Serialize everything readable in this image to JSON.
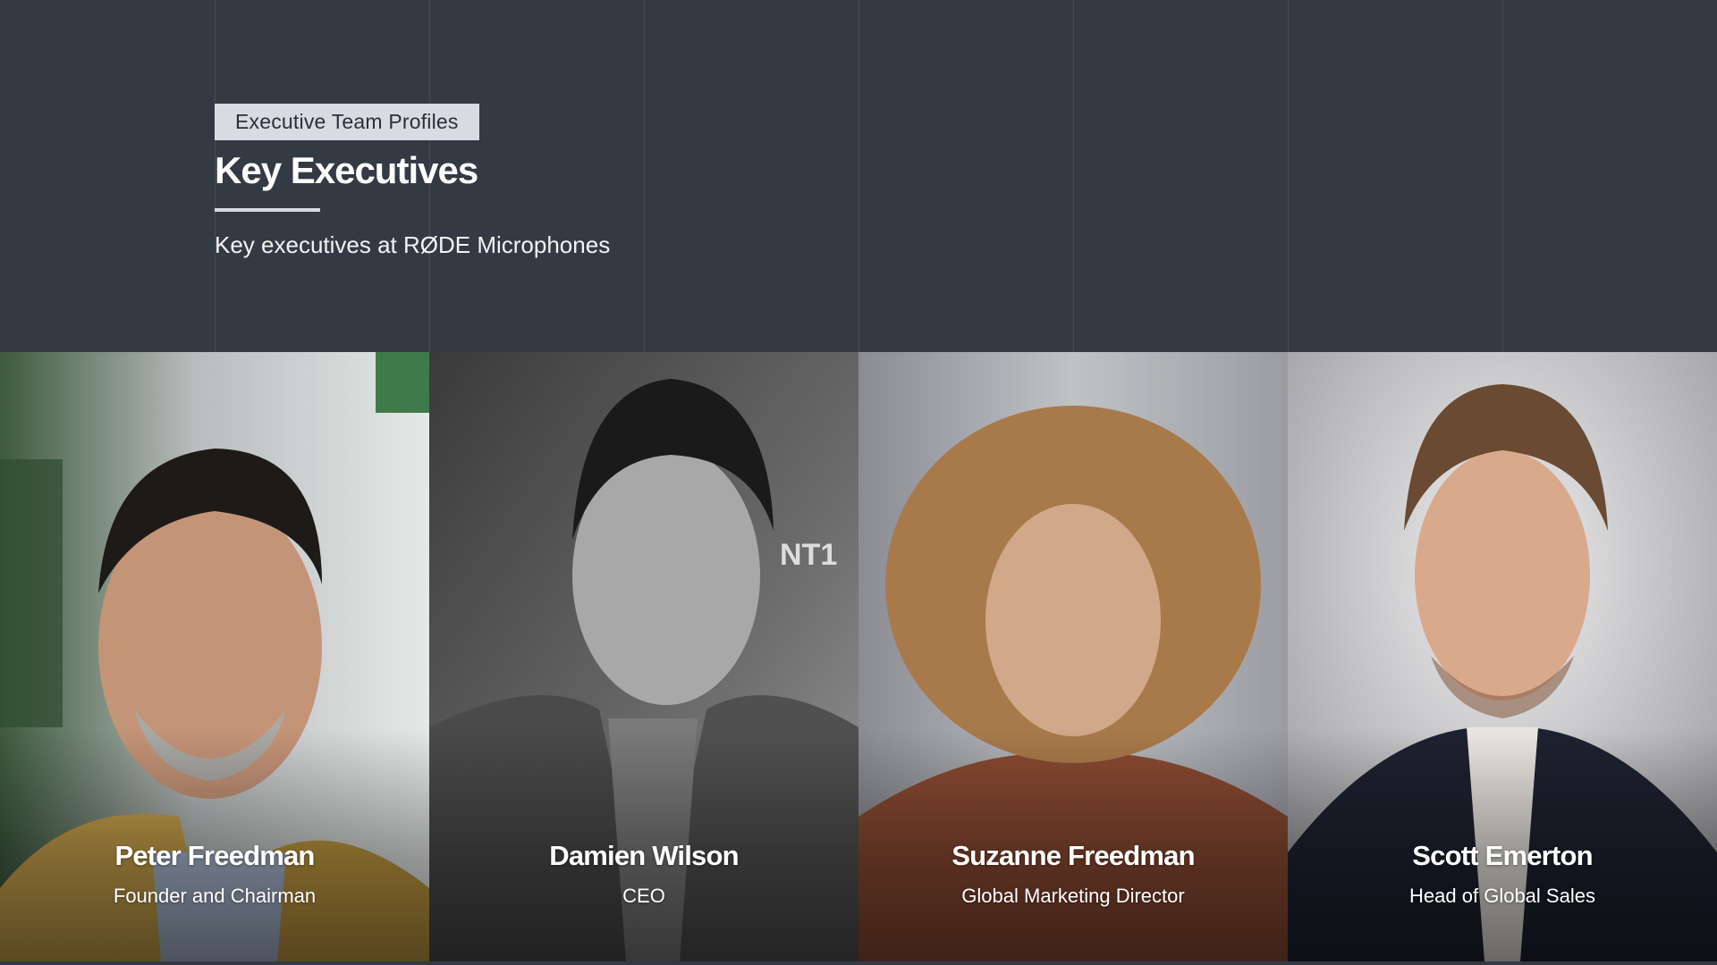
{
  "header": {
    "eyebrow": "Executive Team Profiles",
    "title": "Key Executives",
    "subtitle": "Key executives at RØDE Microphones"
  },
  "executives": [
    {
      "name": "Peter Freedman",
      "role": "Founder and Chairman"
    },
    {
      "name": "Damien Wilson",
      "role": "CEO"
    },
    {
      "name": "Suzanne Freedman",
      "role": "Global Marketing Director"
    },
    {
      "name": "Scott Emerton",
      "role": "Head of Global Sales"
    }
  ],
  "photo_labels": {
    "microphone_text": "NT1"
  },
  "colors": {
    "background": "#343a43",
    "eyebrow_bg": "#d5dde2",
    "text": "#ffffff"
  }
}
